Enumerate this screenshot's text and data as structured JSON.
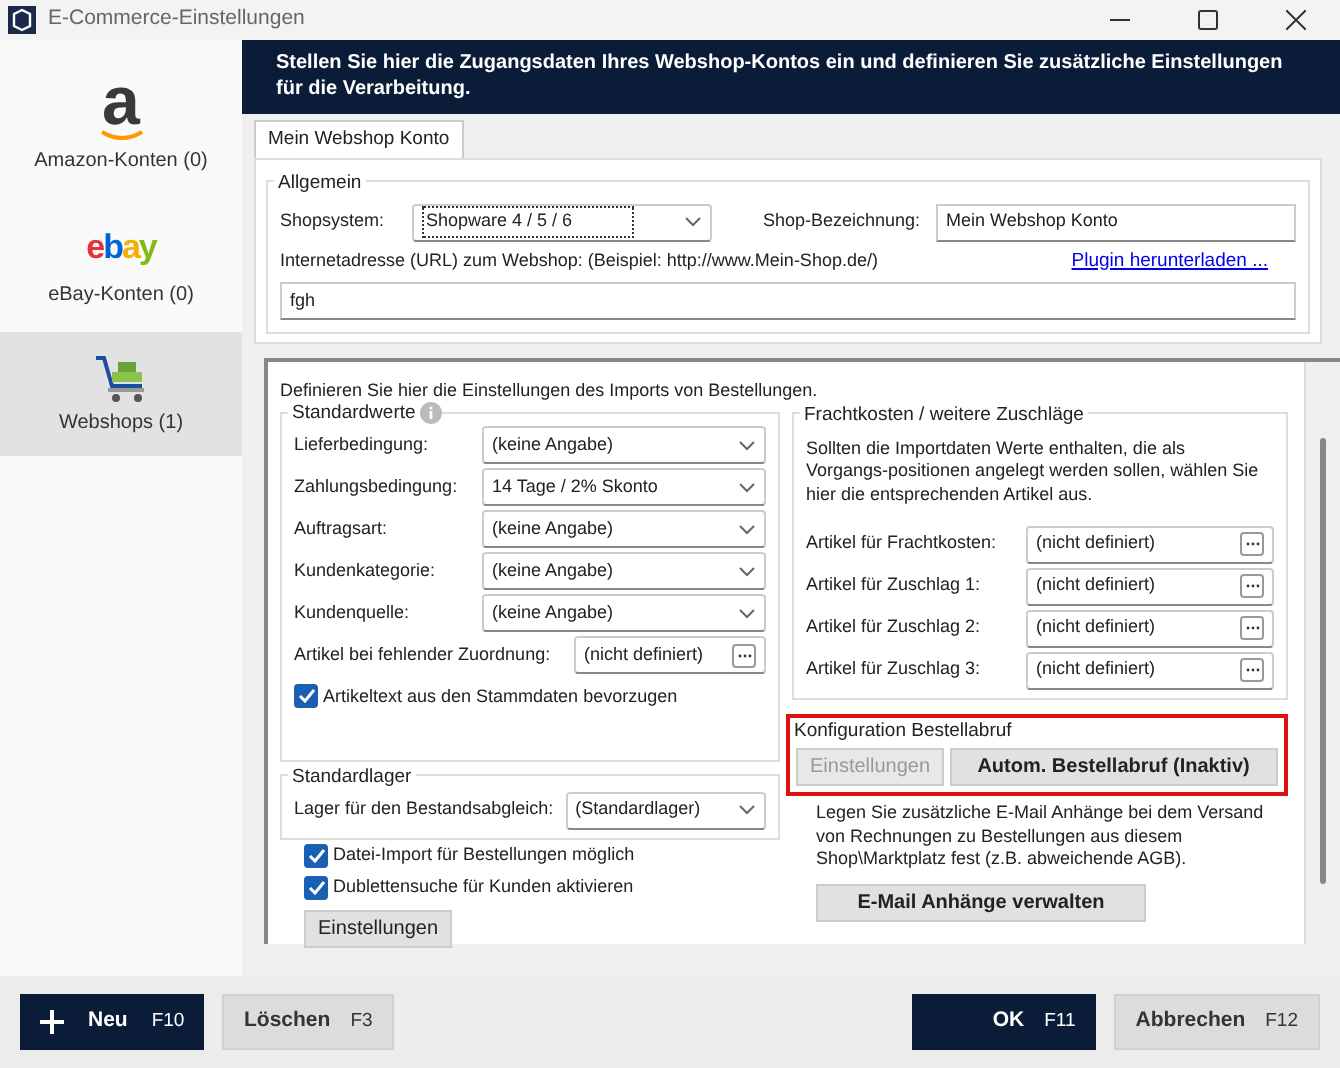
{
  "window": {
    "title": "E-Commerce-Einstellungen"
  },
  "sidebar": {
    "items": [
      {
        "kind": "amazon",
        "logo_text": "a",
        "label": "Amazon-Konten (0)",
        "selected": false
      },
      {
        "kind": "ebay",
        "logo_text": "ebay",
        "label": "eBay-Konten (0)",
        "selected": false
      },
      {
        "kind": "webshop",
        "label": "Webshops (1)",
        "selected": true
      }
    ]
  },
  "header": {
    "text": "Stellen Sie hier die Zugangsdaten Ihres Webshop-Kontos ein und definieren Sie zusätzliche Einstellungen für die Verarbeitung."
  },
  "tabs": [
    {
      "label": "Mein Webshop Konto",
      "selected": true
    }
  ],
  "general": {
    "legend": "Allgemein",
    "shop_system_label": "Shopsystem:",
    "shop_system_value": "Shopware 4 / 5 / 6",
    "shop_name_label": "Shop-Bezeichnung:",
    "shop_name_value": "Mein Webshop Konto",
    "url_label": "Internetadresse (URL) zum Webshop: (Beispiel: http://www.Mein-Shop.de/)",
    "plugin_link": "Plugin herunterladen ...",
    "url_value": "fgh"
  },
  "import": {
    "intro": "Definieren Sie hier die Einstellungen des Imports von Bestellungen.",
    "standard_values": {
      "legend": "Standardwerte",
      "rows": [
        {
          "kind": "select",
          "label": "Lieferbedingung:",
          "value": "(keine Angabe)"
        },
        {
          "kind": "select",
          "label": "Zahlungsbedingung:",
          "value": "14 Tage / 2% Skonto"
        },
        {
          "kind": "select",
          "label": "Auftragsart:",
          "value": "(keine Angabe)"
        },
        {
          "kind": "select",
          "label": "Kundenkategorie:",
          "value": "(keine Angabe)"
        },
        {
          "kind": "select",
          "label": "Kundenquelle:",
          "value": "(keine Angabe)"
        },
        {
          "kind": "picker",
          "label": "Artikel bei fehlender Zuordnung:",
          "value": "(nicht definiert)"
        }
      ],
      "checkbox": {
        "label": "Artikeltext aus den Stammdaten bevorzugen",
        "checked": true
      }
    },
    "warehouse": {
      "legend": "Standardlager",
      "label": "Lager für den Bestandsabgleich:",
      "value": "(Standardlager)"
    },
    "checkboxes": [
      {
        "label": "Datei-Import für Bestellungen möglich",
        "checked": true
      },
      {
        "label": "Dublettensuche für Kunden aktivieren",
        "checked": true
      }
    ],
    "settings_button": "Einstellungen"
  },
  "freight": {
    "legend": "Frachtkosten / weitere Zuschläge",
    "description": "Sollten die Importdaten Werte enthalten, die als Vorgangs-positionen angelegt werden sollen, wählen Sie hier die entsprechenden Artikel aus.",
    "rows": [
      {
        "label": "Artikel für Frachtkosten:",
        "value": "(nicht definiert)"
      },
      {
        "label": "Artikel für Zuschlag 1:",
        "value": "(nicht definiert)"
      },
      {
        "label": "Artikel für Zuschlag 2:",
        "value": "(nicht definiert)"
      },
      {
        "label": "Artikel für Zuschlag 3:",
        "value": "(nicht definiert)"
      }
    ]
  },
  "order_retrieval": {
    "legend": "Konfiguration Bestellabruf",
    "highlighted": true,
    "buttons": [
      {
        "label": "Einstellungen",
        "disabled": true
      },
      {
        "label": "Autom. Bestellabruf (Inaktiv)",
        "disabled": false
      }
    ]
  },
  "attachments": {
    "description": "Legen Sie zusätzliche E-Mail Anhänge bei dem Versand von Rechnungen zu Bestellungen aus diesem Shop\\Marktplatz fest (z.B. abweichende AGB).",
    "button": "E-Mail Anhänge verwalten"
  },
  "footer": {
    "buttons": [
      {
        "kind": "add",
        "label": "Neu",
        "key": "F10"
      },
      {
        "kind": "secondary",
        "label": "Löschen",
        "key": "F3"
      },
      {
        "kind": "primary",
        "label": "OK",
        "key": "F11"
      },
      {
        "kind": "secondary",
        "label": "Abbrechen",
        "key": "F12"
      }
    ]
  }
}
